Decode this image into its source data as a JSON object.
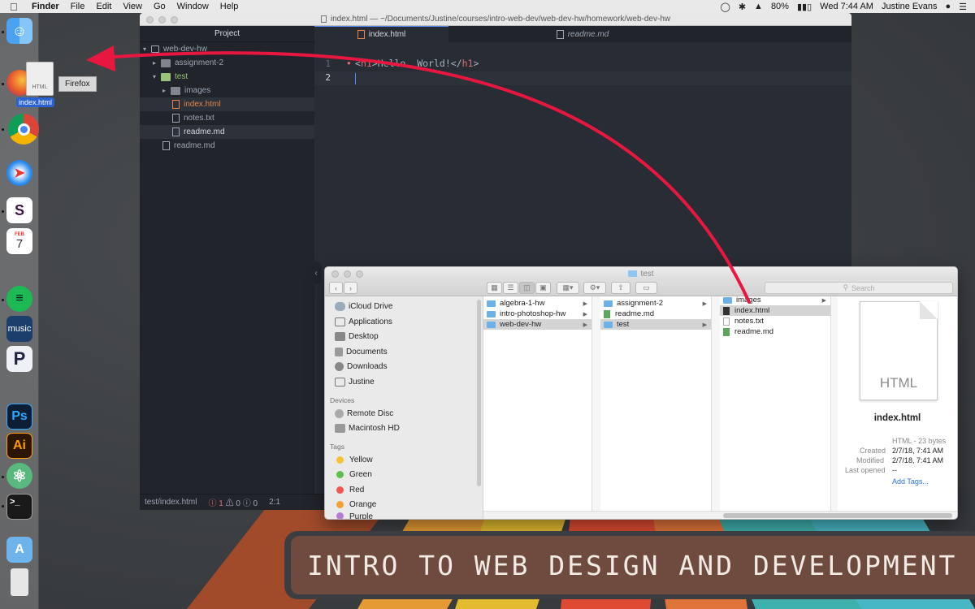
{
  "menubar": {
    "app": "Finder",
    "menus": [
      "File",
      "Edit",
      "View",
      "Go",
      "Window",
      "Help"
    ],
    "battery": "80%",
    "clock": "Wed 7:44 AM",
    "user": "Justine Evans"
  },
  "dock": {
    "apps": [
      "Finder",
      "Firefox",
      "Chrome",
      "Safari",
      "Slack",
      "Calendar",
      "Spotify",
      "Amazon Music",
      "Pandora",
      "Photoshop",
      "Illustrator",
      "Atom",
      "Terminal",
      "Applications",
      "Trash"
    ],
    "calendar_month": "FEB",
    "calendar_day": "7",
    "music_label": "music",
    "ps_label": "Ps",
    "ai_label": "Ai"
  },
  "drag": {
    "ghost_type": "HTML",
    "ghost_label": "index.html",
    "tooltip": "Firefox"
  },
  "atom": {
    "title": "index.html — ~/Documents/Justine/courses/intro-web-dev/web-dev-hw/homework/web-dev-hw",
    "tree_header": "Project",
    "tree": {
      "root": "web-dev-hw",
      "assignment": "assignment-2",
      "test": "test",
      "images": "images",
      "index": "index.html",
      "notes": "notes.txt",
      "readme_inner": "readme.md",
      "readme_outer": "readme.md"
    },
    "tabs": {
      "active": "index.html",
      "inactive": "readme.md"
    },
    "code": {
      "line1_no": "1",
      "line2_no": "2",
      "open_bracket": "<",
      "open_tag": "h1",
      "close_open": ">",
      "text": "Hello, World!",
      "close_bracket": "</",
      "close_tag": "h1",
      "end": ">"
    },
    "status": {
      "path": "test/index.html",
      "errors": "1",
      "warnings": "0",
      "infos": "0",
      "position": "2:1"
    }
  },
  "finder": {
    "title": "test",
    "search_placeholder": "Search",
    "sidebar": {
      "favorites": [
        "iCloud Drive",
        "Applications",
        "Desktop",
        "Documents",
        "Downloads",
        "Justine"
      ],
      "devices_header": "Devices",
      "devices": [
        "Remote Disc",
        "Macintosh HD"
      ],
      "tags_header": "Tags",
      "tags": [
        {
          "name": "Yellow",
          "color": "#f5c331"
        },
        {
          "name": "Green",
          "color": "#5ec24a"
        },
        {
          "name": "Red",
          "color": "#f0564f"
        },
        {
          "name": "Orange",
          "color": "#f5a033"
        },
        {
          "name": "Purple",
          "color": "#b77bd6"
        }
      ]
    },
    "col1": [
      "algebra-1-hw",
      "intro-photoshop-hw",
      "web-dev-hw"
    ],
    "col2": [
      "assignment-2",
      "readme.md",
      "test"
    ],
    "col3": [
      "images",
      "index.html",
      "notes.txt",
      "readme.md"
    ],
    "preview": {
      "ext": "HTML",
      "name": "index.html",
      "kind": "HTML - 23 bytes",
      "created_label": "Created",
      "created": "2/7/18, 7:41 AM",
      "modified_label": "Modified",
      "modified": "2/7/18, 7:41 AM",
      "opened_label": "Last opened",
      "opened": "--",
      "add_tags": "Add Tags..."
    }
  },
  "banner": {
    "text": "INTRO TO WEB DESIGN AND DEVELOPMENT"
  },
  "colors": {
    "arrow": "#e8173f",
    "atom_bg": "#282c34",
    "banner": "#6e4a3f"
  }
}
